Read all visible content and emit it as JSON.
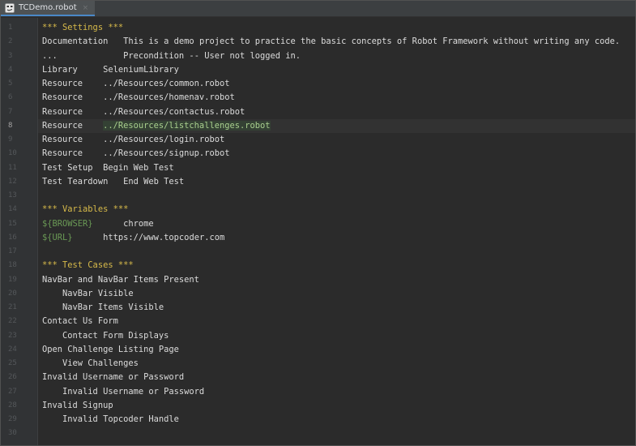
{
  "tab": {
    "filename": "TCDemo.robot",
    "close_symbol": "×"
  },
  "colors": {
    "background": "#2b2b2b",
    "section_header": "#d7ba4a",
    "variable": "#6a9955",
    "highlight_text": "#a9d08e"
  },
  "current_line": 8,
  "line_numbers": [
    "1",
    "2",
    "3",
    "4",
    "5",
    "6",
    "7",
    "8",
    "9",
    "10",
    "11",
    "12",
    "13",
    "14",
    "15",
    "16",
    "17",
    "18",
    "19",
    "20",
    "21",
    "22",
    "23",
    "24",
    "25",
    "26",
    "27",
    "28",
    "29",
    "30"
  ],
  "lines": [
    {
      "type": "section",
      "text": "*** Settings ***"
    },
    {
      "type": "pair",
      "key": "Documentation",
      "pad": "   ",
      "value": "This is a demo project to practice the basic concepts of Robot Framework without writing any code."
    },
    {
      "type": "pair",
      "key": "...",
      "pad": "             ",
      "value": "Precondition -- User not logged in."
    },
    {
      "type": "pair",
      "key": "Library",
      "pad": "     ",
      "value": "SeleniumLibrary"
    },
    {
      "type": "pair",
      "key": "Resource",
      "pad": "    ",
      "value": "../Resources/common.robot"
    },
    {
      "type": "pair",
      "key": "Resource",
      "pad": "    ",
      "value": "../Resources/homenav.robot"
    },
    {
      "type": "pair",
      "key": "Resource",
      "pad": "    ",
      "value": "../Resources/contactus.robot"
    },
    {
      "type": "pair-hl",
      "key": "Resource",
      "pad": "    ",
      "value": "../Resources/listchallenges.robot"
    },
    {
      "type": "pair",
      "key": "Resource",
      "pad": "    ",
      "value": "../Resources/login.robot"
    },
    {
      "type": "pair",
      "key": "Resource",
      "pad": "    ",
      "value": "../Resources/signup.robot"
    },
    {
      "type": "pair",
      "key": "Test Setup",
      "pad": "  ",
      "value": "Begin Web Test"
    },
    {
      "type": "pair",
      "key": "Test Teardown",
      "pad": "   ",
      "value": "End Web Test"
    },
    {
      "type": "blank",
      "text": ""
    },
    {
      "type": "section",
      "text": "*** Variables ***"
    },
    {
      "type": "var",
      "key": "${BROWSER}",
      "pad": "      ",
      "value": "chrome"
    },
    {
      "type": "var",
      "key": "${URL}",
      "pad": "      ",
      "value": "https://www.topcoder.com"
    },
    {
      "type": "blank",
      "text": ""
    },
    {
      "type": "section",
      "text": "*** Test Cases ***"
    },
    {
      "type": "plain",
      "text": "NavBar and NavBar Items Present"
    },
    {
      "type": "plain",
      "text": "    NavBar Visible"
    },
    {
      "type": "plain",
      "text": "    NavBar Items Visible"
    },
    {
      "type": "plain",
      "text": "Contact Us Form"
    },
    {
      "type": "plain",
      "text": "    Contact Form Displays"
    },
    {
      "type": "plain",
      "text": "Open Challenge Listing Page"
    },
    {
      "type": "plain",
      "text": "    View Challenges"
    },
    {
      "type": "plain",
      "text": "Invalid Username or Password"
    },
    {
      "type": "plain",
      "text": "    Invalid Username or Password"
    },
    {
      "type": "plain",
      "text": "Invalid Signup"
    },
    {
      "type": "plain",
      "text": "    Invalid Topcoder Handle"
    },
    {
      "type": "blank",
      "text": ""
    }
  ]
}
